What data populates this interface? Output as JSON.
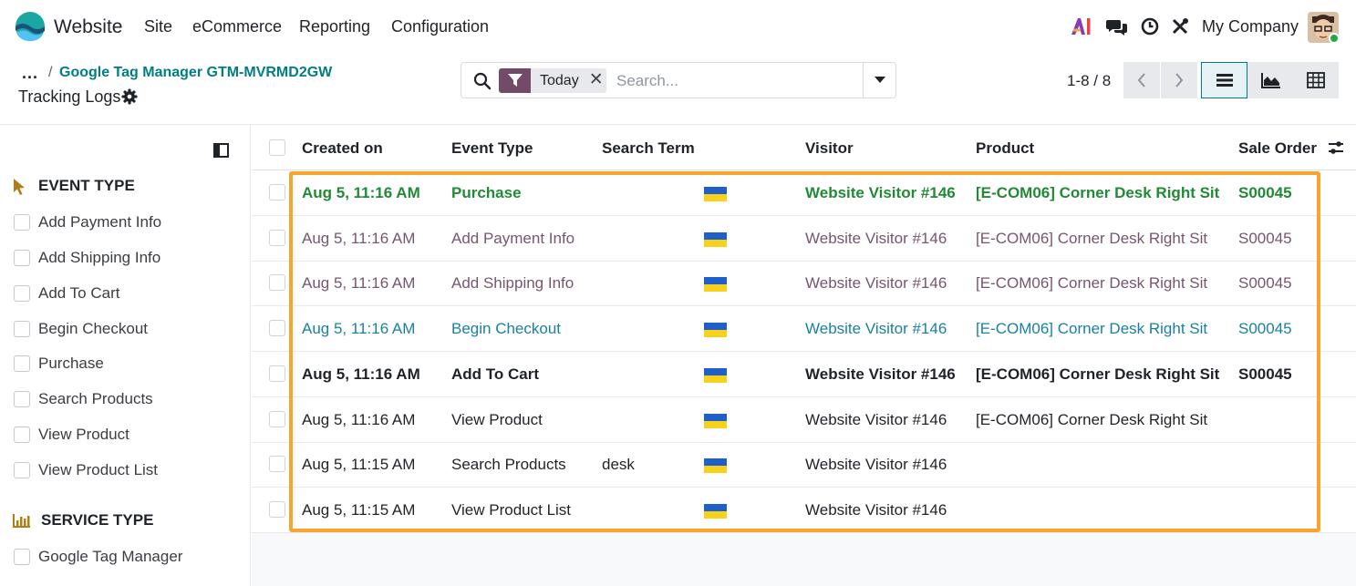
{
  "navbar": {
    "app_name": "Website",
    "menu": [
      "Site",
      "eCommerce",
      "Reporting",
      "Configuration"
    ],
    "company": "My Company",
    "icons": [
      "ai-icon",
      "chat-icon",
      "activity-clock-icon",
      "tools-icon"
    ]
  },
  "breadcrumb": {
    "ellipsis": "...",
    "separator": "/",
    "parent": "Google Tag Manager GTM-MVRMD2GW",
    "current": "Tracking Logs"
  },
  "search": {
    "facet_label": "Today",
    "placeholder": "Search..."
  },
  "pager": {
    "text": "1-8 / 8"
  },
  "views": [
    "list",
    "graph",
    "pivot"
  ],
  "sidebar": {
    "event_type": {
      "title": "EVENT TYPE",
      "items": [
        "Add Payment Info",
        "Add Shipping Info",
        "Add To Cart",
        "Begin Checkout",
        "Purchase",
        "Search Products",
        "View Product",
        "View Product List"
      ]
    },
    "service_type": {
      "title": "SERVICE TYPE",
      "items": [
        "Google Tag Manager"
      ]
    }
  },
  "table": {
    "headers": [
      "Created on",
      "Event Type",
      "Search Term",
      "Visitor",
      "Product",
      "Sale Order"
    ],
    "rows": [
      {
        "created": "Aug 5, 11:16 AM",
        "event": "Purchase",
        "term": "",
        "visitor": "Website Visitor #146",
        "product": "[E-COM06] Corner Desk Right Sit",
        "order": "S00045",
        "tone": "success"
      },
      {
        "created": "Aug 5, 11:16 AM",
        "event": "Add Payment Info",
        "term": "",
        "visitor": "Website Visitor #146",
        "product": "[E-COM06] Corner Desk Right Sit",
        "order": "S00045",
        "tone": "muted"
      },
      {
        "created": "Aug 5, 11:16 AM",
        "event": "Add Shipping Info",
        "term": "",
        "visitor": "Website Visitor #146",
        "product": "[E-COM06] Corner Desk Right Sit",
        "order": "S00045",
        "tone": "muted"
      },
      {
        "created": "Aug 5, 11:16 AM",
        "event": "Begin Checkout",
        "term": "",
        "visitor": "Website Visitor #146",
        "product": "[E-COM06] Corner Desk Right Sit",
        "order": "S00045",
        "tone": "info"
      },
      {
        "created": "Aug 5, 11:16 AM",
        "event": "Add To Cart",
        "term": "",
        "visitor": "Website Visitor #146",
        "product": "[E-COM06] Corner Desk Right Sit",
        "order": "S00045",
        "tone": "bold"
      },
      {
        "created": "Aug 5, 11:16 AM",
        "event": "View Product",
        "term": "",
        "visitor": "Website Visitor #146",
        "product": "[E-COM06] Corner Desk Right Sit",
        "order": "",
        "tone": "default"
      },
      {
        "created": "Aug 5, 11:15 AM",
        "event": "Search Products",
        "term": "desk",
        "visitor": "Website Visitor #146",
        "product": "",
        "order": "",
        "tone": "default"
      },
      {
        "created": "Aug 5, 11:15 AM",
        "event": "View Product List",
        "term": "",
        "visitor": "Website Visitor #146",
        "product": "",
        "order": "",
        "tone": "default"
      }
    ]
  },
  "colors": {
    "brand": "#714b67",
    "link": "#017e84",
    "highlight": "#f7a52f",
    "success": "#218a35",
    "info": "#1a80a3",
    "muted": "#76566f"
  }
}
